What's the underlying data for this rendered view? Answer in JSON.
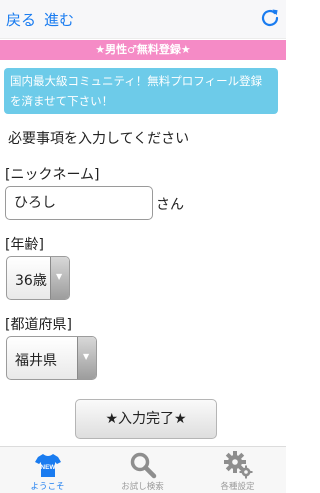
{
  "nav": {
    "back_label": "戻る",
    "forward_label": "進む",
    "reload_icon": "reload-icon"
  },
  "banner": {
    "text": "★男性♂無料登録★",
    "color": "#f58bc6"
  },
  "notice": {
    "text": "国内最大級コミュニティ！無料プロフィール登録を済ませて下さい！",
    "color": "#6dcbe9"
  },
  "form": {
    "instruction": "必要事項を入力してください",
    "nickname": {
      "label": "[ニックネーム]",
      "value": "ひろし",
      "suffix": "さん"
    },
    "age": {
      "label": "[年齢]",
      "selected": "36歳"
    },
    "prefecture": {
      "label": "[都道府県]",
      "selected": "福井県"
    },
    "submit_label": "★入力完了★"
  },
  "tabbar": {
    "active_color": "#1a7cf0",
    "tabs": [
      {
        "label": "ようこそ",
        "icon": "new-shirt-icon",
        "badge": "NEW"
      },
      {
        "label": "お試し検索",
        "icon": "search-icon"
      },
      {
        "label": "各種設定",
        "icon": "gear-icon"
      }
    ]
  }
}
